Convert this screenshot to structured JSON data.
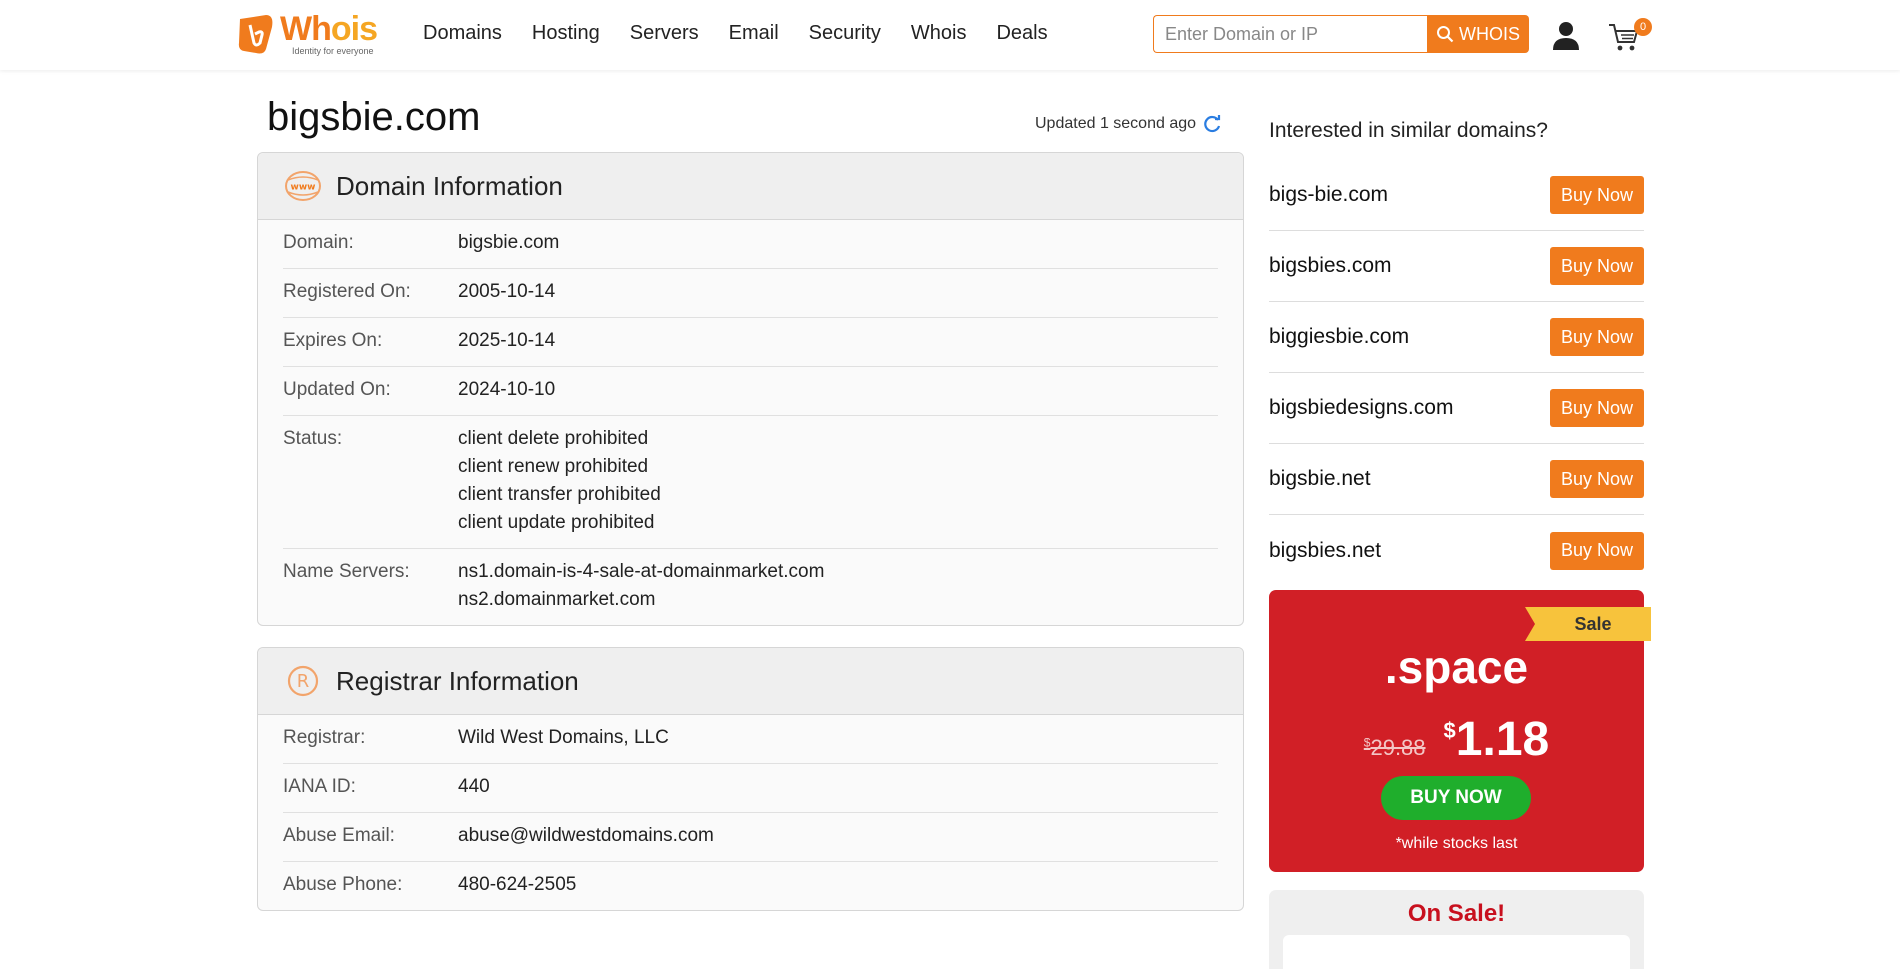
{
  "header": {
    "logo": {
      "word_a": "Wh",
      "word_b": "ois",
      "tagline": "Identity for everyone"
    },
    "nav": [
      "Domains",
      "Hosting",
      "Servers",
      "Email",
      "Security",
      "Whois",
      "Deals"
    ],
    "search": {
      "placeholder": "Enter Domain or IP",
      "value": "",
      "button_label": "WHOIS"
    },
    "cart": {
      "count": "0"
    },
    "colors": {
      "accent": "#f07b1d",
      "logo_yellow": "#f5a623"
    }
  },
  "page": {
    "title": "bigsbie.com",
    "updated": "Updated 1 second ago"
  },
  "domain_info": {
    "title": "Domain Information",
    "rows": [
      {
        "label": "Domain:",
        "values": [
          "bigsbie.com"
        ]
      },
      {
        "label": "Registered On:",
        "values": [
          "2005-10-14"
        ]
      },
      {
        "label": "Expires On:",
        "values": [
          "2025-10-14"
        ]
      },
      {
        "label": "Updated On:",
        "values": [
          "2024-10-10"
        ]
      },
      {
        "label": "Status:",
        "values": [
          "client delete prohibited",
          "client renew prohibited",
          "client transfer prohibited",
          "client update prohibited"
        ]
      },
      {
        "label": "Name Servers:",
        "values": [
          "ns1.domain-is-4-sale-at-domainmarket.com",
          "ns2.domainmarket.com"
        ]
      }
    ]
  },
  "registrar_info": {
    "title": "Registrar Information",
    "rows": [
      {
        "label": "Registrar:",
        "values": [
          "Wild West Domains, LLC"
        ]
      },
      {
        "label": "IANA ID:",
        "values": [
          "440"
        ]
      },
      {
        "label": "Abuse Email:",
        "values": [
          "abuse@wildwestdomains.com"
        ]
      },
      {
        "label": "Abuse Phone:",
        "values": [
          "480-624-2505"
        ]
      }
    ]
  },
  "sidebar": {
    "similar_title": "Interested in similar domains?",
    "buy_label": "Buy Now",
    "similar": [
      "bigs-bie.com",
      "bigsbies.com",
      "biggiesbie.com",
      "bigsbiedesigns.com",
      "bigsbie.net",
      "bigsbies.net"
    ],
    "sale": {
      "ribbon": "Sale",
      "tld": ".space",
      "currency": "$",
      "old_price": "29.88",
      "new_price": "1.18",
      "button": "BUY NOW",
      "note": "*while stocks last",
      "colors": {
        "bg": "#d11f26",
        "button": "#1fae2c",
        "ribbon": "#f7c33c"
      }
    },
    "on_sale_title": "On Sale!"
  }
}
